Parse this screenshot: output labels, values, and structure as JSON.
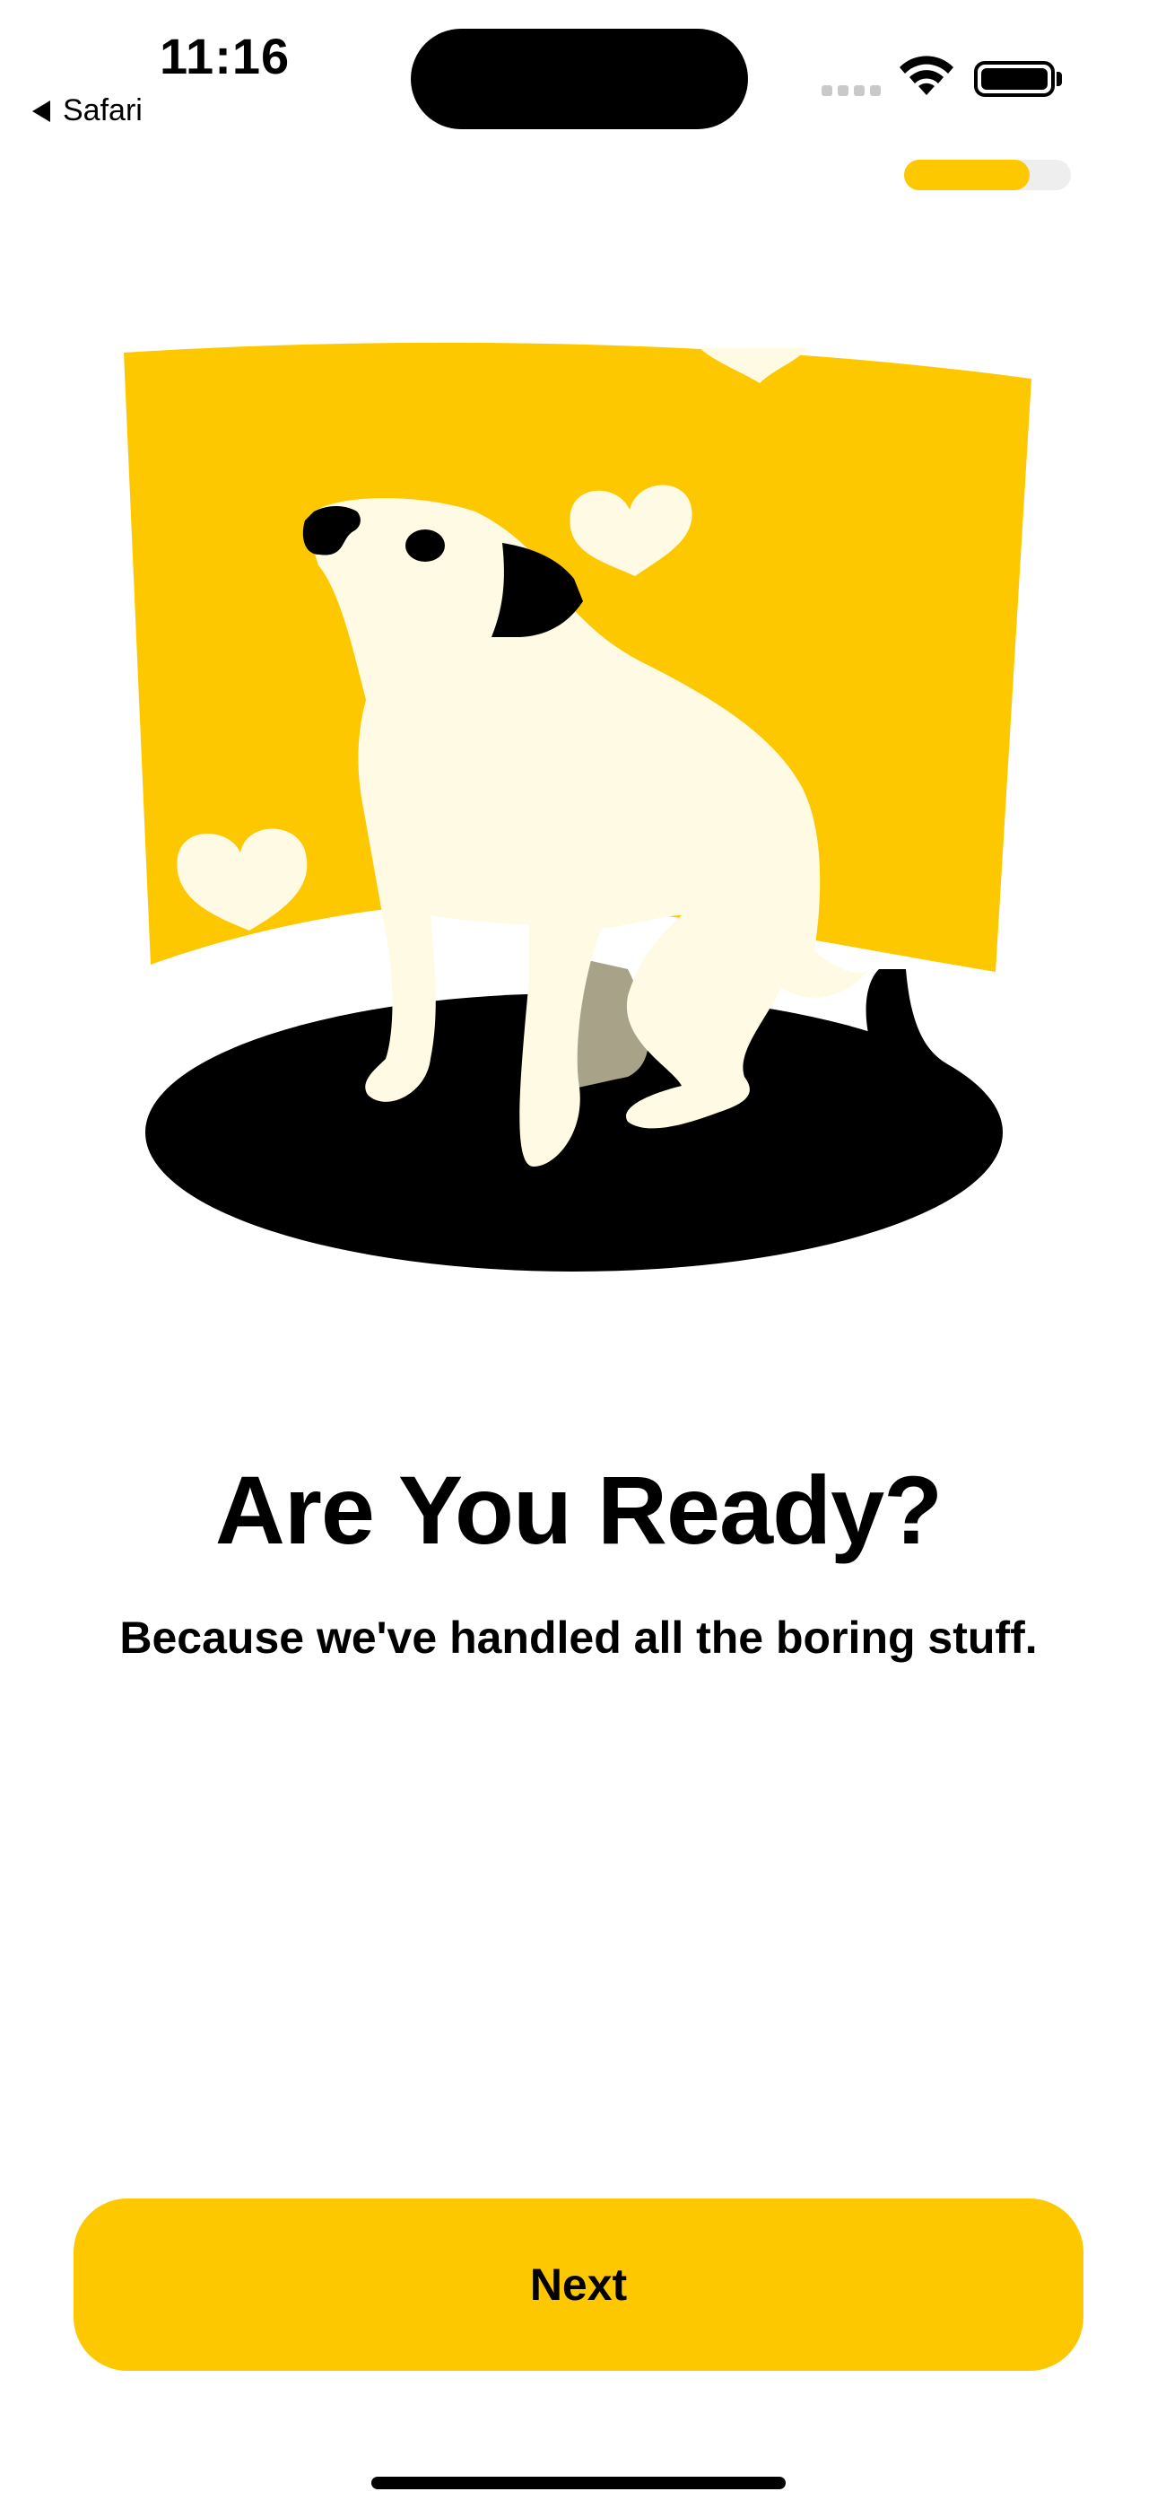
{
  "status_bar": {
    "time": "11:16",
    "back_label": "Safari",
    "icons": [
      "cellular-signal-icon",
      "wifi-icon",
      "battery-icon"
    ]
  },
  "progress": {
    "value": 0.75
  },
  "illustration": {
    "name": "dog-with-hearts",
    "colors": {
      "accent": "#fdc800",
      "dog": "#fefae3",
      "shadow": "#000000",
      "hind": "#a8a288"
    }
  },
  "onboarding": {
    "title": "Are You Ready?",
    "subtitle": "Because we've handled all the boring stuff.",
    "next_label": "Next"
  },
  "colors": {
    "brand": "#fdc800",
    "text": "#000000",
    "background": "#ffffff"
  }
}
